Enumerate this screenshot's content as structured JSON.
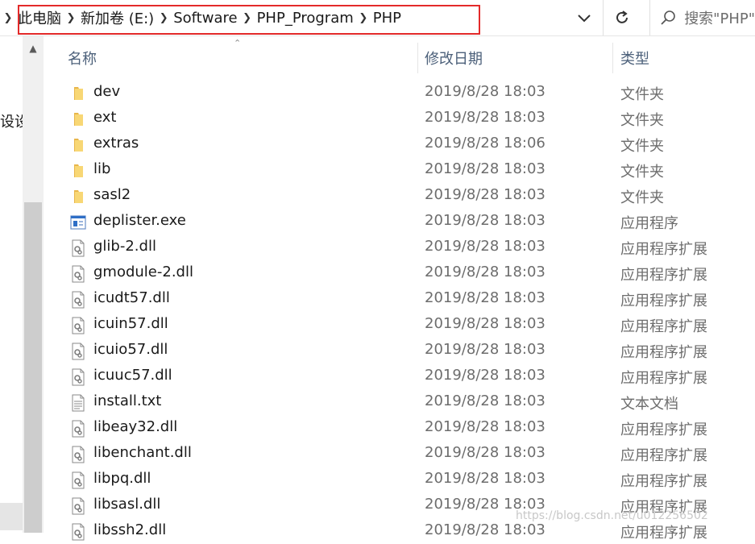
{
  "address_bar": {
    "breadcrumbs": [
      "此电脑",
      "新加卷 (E:)",
      "Software",
      "PHP_Program",
      "PHP"
    ],
    "search_placeholder": "搜索\"PHP\""
  },
  "nav_pane": {
    "partial_label": "设设"
  },
  "columns": {
    "name": "名称",
    "date": "修改日期",
    "type": "类型"
  },
  "files": [
    {
      "name": "dev",
      "date": "2019/8/28 18:03",
      "type": "文件夹",
      "icon": "folder-icon"
    },
    {
      "name": "ext",
      "date": "2019/8/28 18:03",
      "type": "文件夹",
      "icon": "folder-icon"
    },
    {
      "name": "extras",
      "date": "2019/8/28 18:06",
      "type": "文件夹",
      "icon": "folder-icon"
    },
    {
      "name": "lib",
      "date": "2019/8/28 18:03",
      "type": "文件夹",
      "icon": "folder-icon"
    },
    {
      "name": "sasl2",
      "date": "2019/8/28 18:03",
      "type": "文件夹",
      "icon": "folder-icon"
    },
    {
      "name": "deplister.exe",
      "date": "2019/8/28 18:03",
      "type": "应用程序",
      "icon": "exe-icon"
    },
    {
      "name": "glib-2.dll",
      "date": "2019/8/28 18:03",
      "type": "应用程序扩展",
      "icon": "dll-icon"
    },
    {
      "name": "gmodule-2.dll",
      "date": "2019/8/28 18:03",
      "type": "应用程序扩展",
      "icon": "dll-icon"
    },
    {
      "name": "icudt57.dll",
      "date": "2019/8/28 18:03",
      "type": "应用程序扩展",
      "icon": "dll-icon"
    },
    {
      "name": "icuin57.dll",
      "date": "2019/8/28 18:03",
      "type": "应用程序扩展",
      "icon": "dll-icon"
    },
    {
      "name": "icuio57.dll",
      "date": "2019/8/28 18:03",
      "type": "应用程序扩展",
      "icon": "dll-icon"
    },
    {
      "name": "icuuc57.dll",
      "date": "2019/8/28 18:03",
      "type": "应用程序扩展",
      "icon": "dll-icon"
    },
    {
      "name": "install.txt",
      "date": "2019/8/28 18:03",
      "type": "文本文档",
      "icon": "txt-icon"
    },
    {
      "name": "libeay32.dll",
      "date": "2019/8/28 18:03",
      "type": "应用程序扩展",
      "icon": "dll-icon"
    },
    {
      "name": "libenchant.dll",
      "date": "2019/8/28 18:03",
      "type": "应用程序扩展",
      "icon": "dll-icon"
    },
    {
      "name": "libpq.dll",
      "date": "2019/8/28 18:03",
      "type": "应用程序扩展",
      "icon": "dll-icon"
    },
    {
      "name": "libsasl.dll",
      "date": "2019/8/28 18:03",
      "type": "应用程序扩展",
      "icon": "dll-icon"
    },
    {
      "name": "libssh2.dll",
      "date": "2019/8/28 18:03",
      "type": "应用程序扩展",
      "icon": "dll-icon"
    }
  ],
  "watermark": "https://blog.csdn.net/u012256502",
  "colors": {
    "highlight_box": "#e32a2a",
    "header_text": "#4c607a",
    "folder": "#f8d775"
  }
}
